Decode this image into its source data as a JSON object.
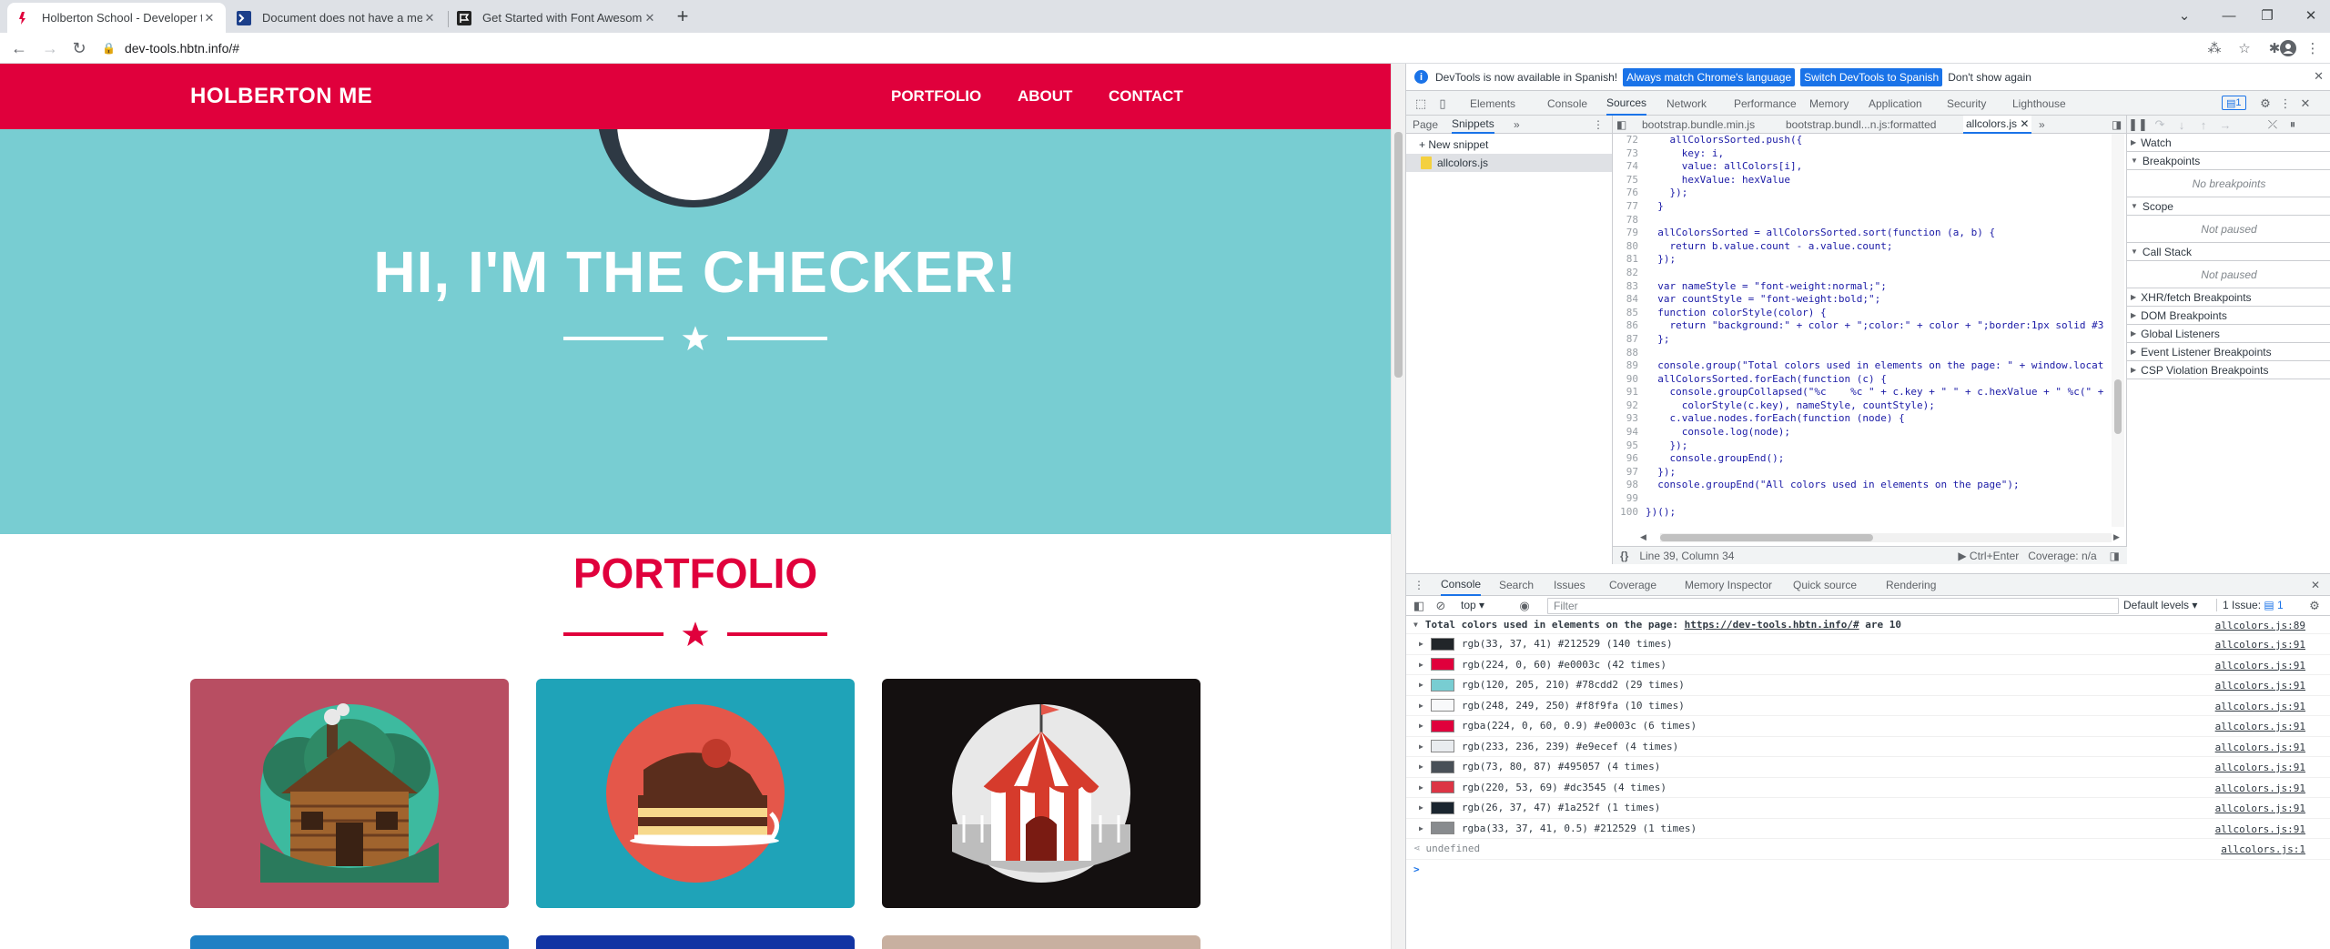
{
  "browser": {
    "tabs": [
      {
        "title": "Holberton School - Developer to",
        "active": true
      },
      {
        "title": "Document does not have a meta",
        "active": false
      },
      {
        "title": "Get Started with Font Awesome",
        "active": false
      }
    ],
    "url": "dev-tools.hbtn.info/#"
  },
  "site": {
    "brand": "HOLBERTON ME",
    "nav": [
      "PORTFOLIO",
      "ABOUT",
      "CONTACT"
    ],
    "hero_title": "HI, I'M THE CHECKER!",
    "portfolio_title": "PORTFOLIO",
    "colors": {
      "primary": "#e0003c",
      "hero": "#78cdd2",
      "dark": "#212529"
    },
    "cards": [
      {
        "icon": "cabin-icon",
        "bg": "#b84e62"
      },
      {
        "icon": "cake-icon",
        "bg": "#1fa3b8"
      },
      {
        "icon": "circus-tent-icon",
        "bg": "#141010"
      }
    ],
    "cards_row2": [
      {
        "bg": "#1f80c4"
      },
      {
        "bg": "#1234a3"
      },
      {
        "bg": "#c8b0a0"
      }
    ]
  },
  "devtools": {
    "infobar": {
      "text": "DevTools is now available in Spanish!",
      "btn1": "Always match Chrome's language",
      "btn2": "Switch DevTools to Spanish",
      "btn3": "Don't show again"
    },
    "tabs": [
      "Elements",
      "Console",
      "Sources",
      "Network",
      "Performance",
      "Memory",
      "Application",
      "Security",
      "Lighthouse"
    ],
    "active_tab": "Sources",
    "issues_badge": "1",
    "navigator_tabs": [
      "Page",
      "Snippets"
    ],
    "new_snippet": "+ New snippet",
    "snippet": "allcolors.js",
    "editor_tabs": [
      "bootstrap.bundle.min.js",
      "bootstrap.bundl...n.js:formatted",
      "allcolors.js"
    ],
    "code_lines": [
      {
        "n": "72",
        "t": "    allColorsSorted.push({"
      },
      {
        "n": "73",
        "t": "      key: i,"
      },
      {
        "n": "74",
        "t": "      value: allColors[i],"
      },
      {
        "n": "75",
        "t": "      hexValue: hexValue"
      },
      {
        "n": "76",
        "t": "    });"
      },
      {
        "n": "77",
        "t": "  }"
      },
      {
        "n": "78",
        "t": ""
      },
      {
        "n": "79",
        "t": "  allColorsSorted = allColorsSorted.sort(function (a, b) {"
      },
      {
        "n": "80",
        "t": "    return b.value.count - a.value.count;"
      },
      {
        "n": "81",
        "t": "  });"
      },
      {
        "n": "82",
        "t": ""
      },
      {
        "n": "83",
        "t": "  var nameStyle = \"font-weight:normal;\";"
      },
      {
        "n": "84",
        "t": "  var countStyle = \"font-weight:bold;\";"
      },
      {
        "n": "85",
        "t": "  function colorStyle(color) {"
      },
      {
        "n": "86",
        "t": "    return \"background:\" + color + \";color:\" + color + \";border:1px solid #3"
      },
      {
        "n": "87",
        "t": "  };"
      },
      {
        "n": "88",
        "t": ""
      },
      {
        "n": "89",
        "t": "  console.group(\"Total colors used in elements on the page: \" + window.locat"
      },
      {
        "n": "90",
        "t": "  allColorsSorted.forEach(function (c) {"
      },
      {
        "n": "91",
        "t": "    console.groupCollapsed(\"%c    %c \" + c.key + \" \" + c.hexValue + \" %c(\" +"
      },
      {
        "n": "92",
        "t": "      colorStyle(c.key), nameStyle, countStyle);"
      },
      {
        "n": "93",
        "t": "    c.value.nodes.forEach(function (node) {"
      },
      {
        "n": "94",
        "t": "      console.log(node);"
      },
      {
        "n": "95",
        "t": "    });"
      },
      {
        "n": "96",
        "t": "    console.groupEnd();"
      },
      {
        "n": "97",
        "t": "  });"
      },
      {
        "n": "98",
        "t": "  console.groupEnd(\"All colors used in elements on the page\");"
      },
      {
        "n": "99",
        "t": ""
      },
      {
        "n": "100",
        "t": "})();"
      }
    ],
    "status": {
      "position": "Line 39, Column 34",
      "run": "Ctrl+Enter",
      "coverage": "Coverage: n/a"
    },
    "debugger": {
      "sections": [
        "Watch",
        "Breakpoints",
        "Scope",
        "Call Stack",
        "XHR/fetch Breakpoints",
        "DOM Breakpoints",
        "Global Listeners",
        "Event Listener Breakpoints",
        "CSP Violation Breakpoints"
      ],
      "no_breakpoints": "No breakpoints",
      "not_paused": "Not paused"
    },
    "drawer_tabs": [
      "Console",
      "Search",
      "Issues",
      "Coverage",
      "Memory Inspector",
      "Quick source",
      "Rendering"
    ],
    "console_toolbar": {
      "context": "top",
      "filter_placeholder": "Filter",
      "levels": "Default levels",
      "issues": "1 Issue:"
    },
    "console": {
      "group_prefix": "Total colors used in elements on the page: ",
      "group_link": "https://dev-tools.hbtn.info/#",
      "group_suffix": " are 10",
      "group_src": "allcolors.js:89",
      "rows": [
        {
          "color": "#212529",
          "text": "rgb(33, 37, 41) #212529 (140 times)",
          "src": "allcolors.js:91"
        },
        {
          "color": "#e0003c",
          "text": "rgb(224, 0, 60) #e0003c (42 times)",
          "src": "allcolors.js:91"
        },
        {
          "color": "#78cdd2",
          "text": "rgb(120, 205, 210) #78cdd2 (29 times)",
          "src": "allcolors.js:91"
        },
        {
          "color": "#f8f9fa",
          "text": "rgb(248, 249, 250) #f8f9fa (10 times)",
          "src": "allcolors.js:91"
        },
        {
          "color": "#e0003c",
          "text": "rgba(224, 0, 60, 0.9) #e0003c (6 times)",
          "src": "allcolors.js:91"
        },
        {
          "color": "#e9ecef",
          "text": "rgb(233, 236, 239) #e9ecef (4 times)",
          "src": "allcolors.js:91"
        },
        {
          "color": "#495057",
          "text": "rgb(73, 80, 87) #495057 (4 times)",
          "src": "allcolors.js:91"
        },
        {
          "color": "#dc3545",
          "text": "rgb(220, 53, 69) #dc3545 (4 times)",
          "src": "allcolors.js:91"
        },
        {
          "color": "#1a252f",
          "text": "rgb(26, 37, 47) #1a252f (1 times)",
          "src": "allcolors.js:91"
        },
        {
          "color": "#888b8e",
          "text": "rgba(33, 37, 41, 0.5) #212529 (1 times)",
          "src": "allcolors.js:91"
        }
      ],
      "undefined_text": "undefined",
      "undefined_src": "allcolors.js:1",
      "prompt": ">"
    }
  }
}
